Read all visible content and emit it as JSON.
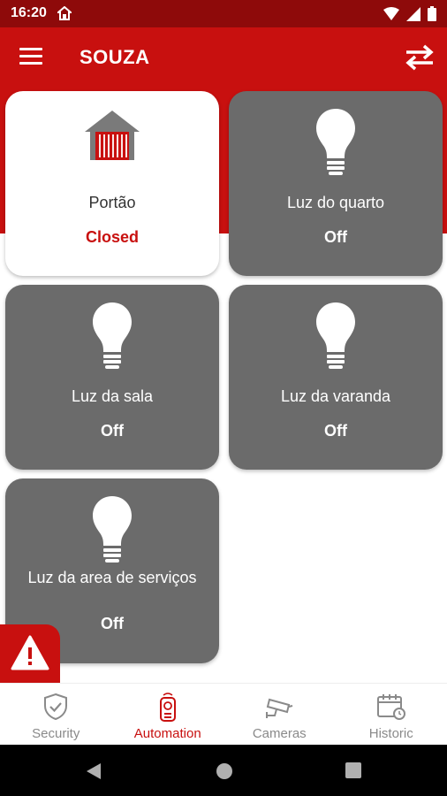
{
  "status_bar": {
    "time": "16:20"
  },
  "app_bar": {
    "title": "SOUZA"
  },
  "devices": [
    {
      "name": "Portão",
      "state": "Closed",
      "icon": "garage-icon"
    },
    {
      "name": "Luz do quarto",
      "state": "Off",
      "icon": "bulb-icon"
    },
    {
      "name": "Luz da sala",
      "state": "Off",
      "icon": "bulb-icon"
    },
    {
      "name": "Luz da varanda",
      "state": "Off",
      "icon": "bulb-icon"
    },
    {
      "name": "Luz da area de serviços",
      "state": "Off",
      "icon": "bulb-icon"
    }
  ],
  "bottom_nav": [
    {
      "label": "Security",
      "icon": "shield-check-icon",
      "active": false
    },
    {
      "label": "Automation",
      "icon": "remote-icon",
      "active": true
    },
    {
      "label": "Cameras",
      "icon": "camera-icon",
      "active": false
    },
    {
      "label": "Historic",
      "icon": "calendar-clock-icon",
      "active": false
    }
  ],
  "colors": {
    "primary": "#c8100f",
    "status_bar": "#8e0a0a",
    "card_off": "#6b6b6b",
    "card_active": "#ffffff"
  }
}
